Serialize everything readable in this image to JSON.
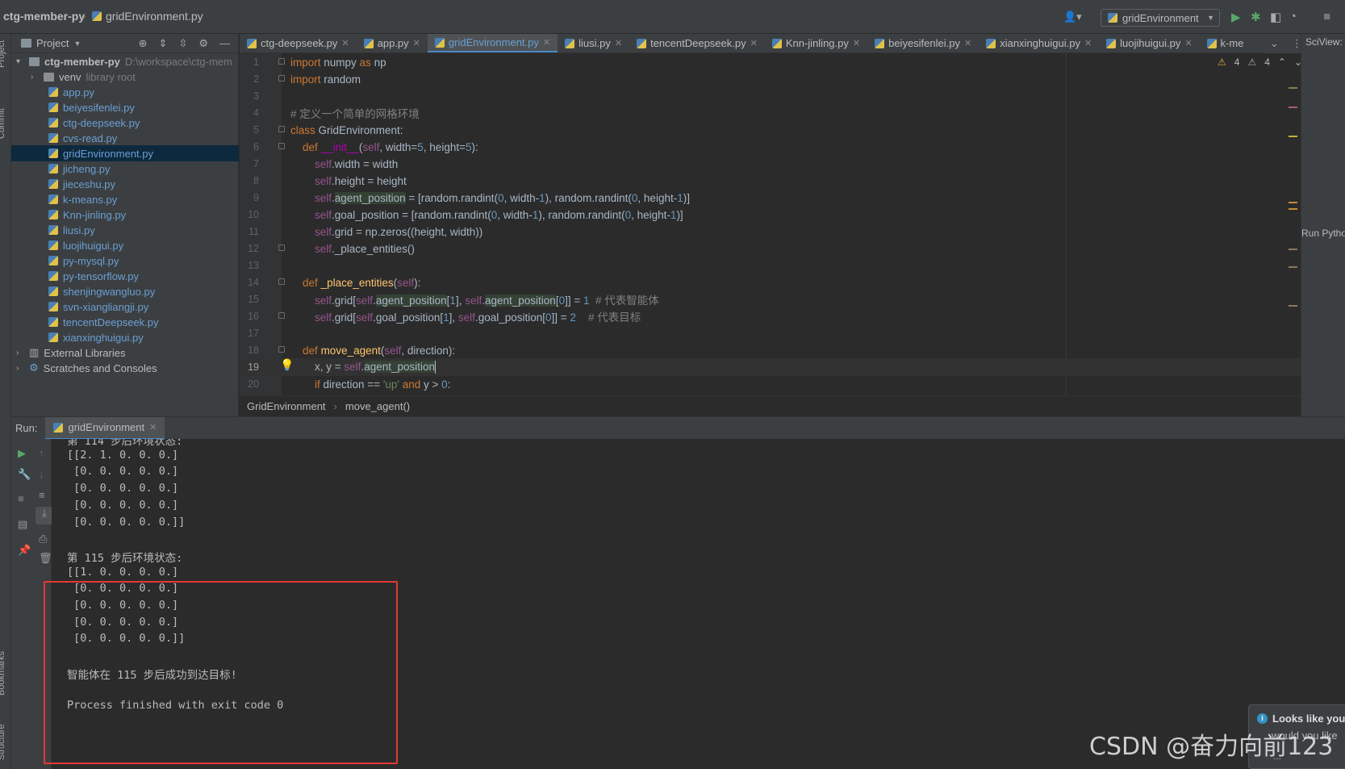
{
  "titlebar": {
    "project": "ctg-member-py",
    "file": "gridEnvironment.py",
    "run_config": "gridEnvironment"
  },
  "left_strip": {
    "project": "Project",
    "commit": "Commit",
    "bookmarks": "Bookmarks",
    "structure": "Structure"
  },
  "project_panel": {
    "title": "Project",
    "root_name": "ctg-member-py",
    "root_path": "D:\\workspace\\ctg-mem",
    "venv": "venv",
    "venv_hint": "library root",
    "files": [
      "app.py",
      "beiyesifenlei.py",
      "ctg-deepseek.py",
      "cvs-read.py",
      "gridEnvironment.py",
      "jicheng.py",
      "jieceshu.py",
      "k-means.py",
      "Knn-jinling.py",
      "liusi.py",
      "luojihuigui.py",
      "py-mysql.py",
      "py-tensorflow.py",
      "shenjingwangluo.py",
      "svn-xiangliangji.py",
      "tencentDeepseek.py",
      "xianxinghuigui.py"
    ],
    "external_libraries": "External Libraries",
    "scratches": "Scratches and Consoles"
  },
  "tabs": [
    "ctg-deepseek.py",
    "app.py",
    "gridEnvironment.py",
    "liusi.py",
    "tencentDeepseek.py",
    "Knn-jinling.py",
    "beiyesifenlei.py",
    "xianxinghuigui.py",
    "luojihuigui.py",
    "k-me"
  ],
  "right_strip": {
    "sciview": "SciView:",
    "run_python": "Run Pytho"
  },
  "editor": {
    "warnings_a": "4",
    "warnings_b": "4",
    "line_numbers": [
      "1",
      "2",
      "3",
      "4",
      "5",
      "6",
      "7",
      "8",
      "9",
      "10",
      "11",
      "12",
      "13",
      "14",
      "15",
      "16",
      "17",
      "18",
      "19",
      "20"
    ],
    "comment_grid": "# 定义一个简单的网格环境",
    "comment_agent": "# 代表智能体",
    "comment_goal": "# 代表目标"
  },
  "breadcrumb": [
    "GridEnvironment",
    "move_agent()"
  ],
  "run_panel": {
    "label": "Run:",
    "tab": "gridEnvironment",
    "console": [
      "第 114 步后环境状态:",
      "[[2. 1. 0. 0. 0.]",
      " [0. 0. 0. 0. 0.]",
      " [0. 0. 0. 0. 0.]",
      " [0. 0. 0. 0. 0.]",
      " [0. 0. 0. 0. 0.]]",
      "",
      "第 115 步后环境状态:",
      "[[1. 0. 0. 0. 0.]",
      " [0. 0. 0. 0. 0.]",
      " [0. 0. 0. 0. 0.]",
      " [0. 0. 0. 0. 0.]",
      " [0. 0. 0. 0. 0.]]",
      "",
      "智能体在 115 步后成功到达目标!",
      "",
      "Process finished with exit code 0"
    ]
  },
  "notification": {
    "title": "Looks like you",
    "body": "would you like",
    "more": "..."
  },
  "watermark": "CSDN @奋力向前123",
  "colors": {
    "highlight_box": "#e53935",
    "accent": "#4a88c7"
  }
}
